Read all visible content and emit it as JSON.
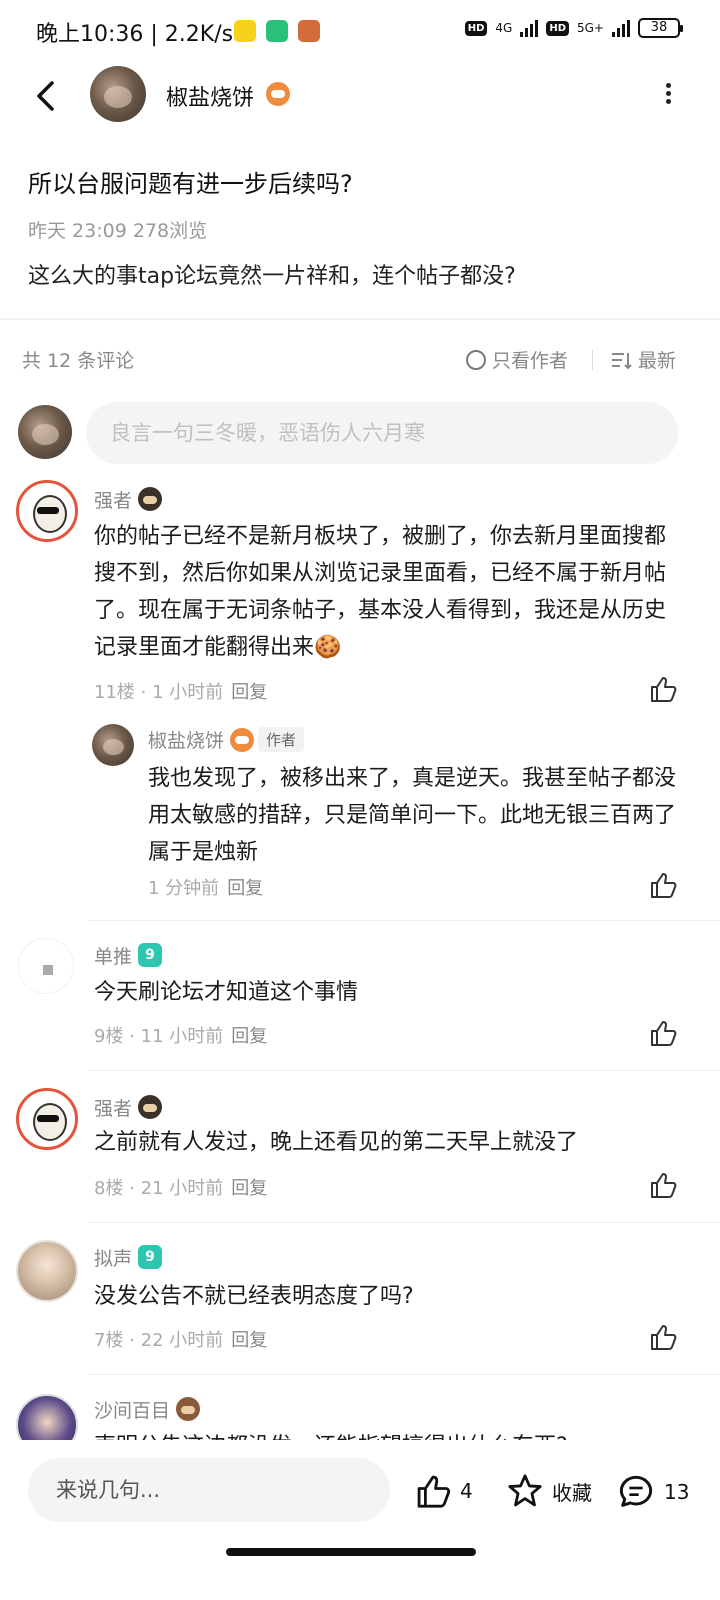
{
  "status_bar": {
    "time": "晚上10:36 | 2.2K/s",
    "net1": "4G",
    "net2": "5G+",
    "battery": "38"
  },
  "header": {
    "author_name": "椒盐烧饼"
  },
  "post": {
    "title": "所以台服问题有进一步后续吗?",
    "meta": "昨天 23:09   278浏览",
    "body": "这么大的事tap论坛竟然一片祥和，连个帖子都没?"
  },
  "comments_header": {
    "count": "共 12 条评论",
    "only_author": "只看作者",
    "sort": "最新"
  },
  "composer": {
    "placeholder": "良言一句三冬暖，恶语伤人六月寒"
  },
  "comments": [
    {
      "name": "强者",
      "text": "你的帖子已经不是新月板块了，被删了，你去新月里面搜都搜不到，然后你如果从浏览记录里面看，已经不属于新月帖了。现在属于无词条帖子，基本没人看得到，我还是从历史记录里面才能翻得出来🍪",
      "meta": "11楼 · 1 小时前",
      "reply": "回复",
      "reply_item": {
        "name": "椒盐烧饼",
        "tag": "作者",
        "text": "我也发现了，被移出来了，真是逆天。我甚至帖子都没用太敏感的措辞，只是简单问一下。此地无银三百两了属于是烛新",
        "meta": "1 分钟前",
        "reply": "回复"
      }
    },
    {
      "name": "单推",
      "text": "今天刷论坛才知道这个事情",
      "meta": "9楼 · 11 小时前",
      "reply": "回复"
    },
    {
      "name": "强者",
      "text": "之前就有人发过，晚上还看见的第二天早上就没了",
      "meta": "8楼 · 21 小时前",
      "reply": "回复"
    },
    {
      "name": "拟声",
      "text": "没发公告不就已经表明态度了吗?",
      "meta": "7楼 · 22 小时前",
      "reply": "回复"
    },
    {
      "name": "沙间百目",
      "text": "声明公告这边都没发，还能指望搞得出什么东西?"
    }
  ],
  "bottom_bar": {
    "input_label": "来说几句...",
    "like_count": "4",
    "fav_label": "收藏",
    "comment_count": "13"
  },
  "colors": {
    "accent_orange": "#f08a3c",
    "level_badge": "#2ec6b0",
    "meta_gray": "#aaaaaa"
  }
}
